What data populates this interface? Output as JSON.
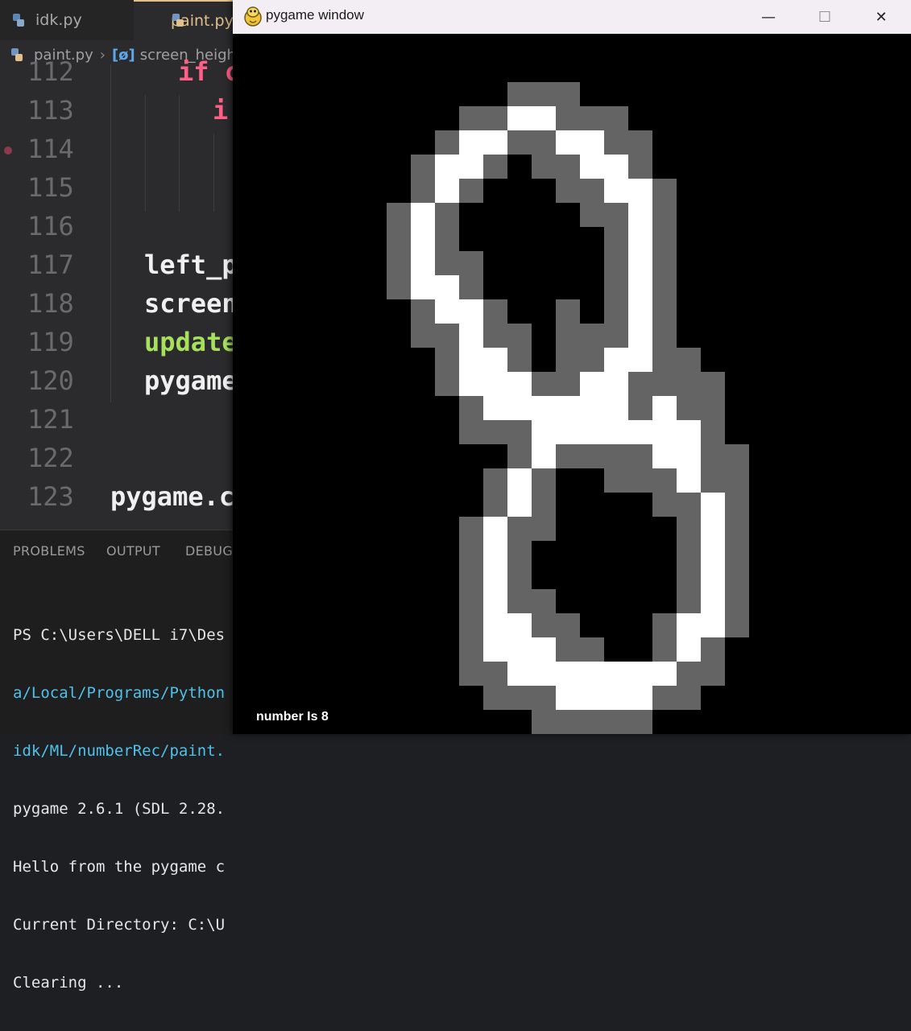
{
  "editor": {
    "tabs": [
      {
        "label": "idk.py"
      },
      {
        "label": "paint.py"
      }
    ],
    "breadcrumb": {
      "file": "paint.py",
      "symbol": "screen_height"
    },
    "code_lines": [
      {
        "num": "112",
        "text": "if c"
      },
      {
        "num": "113",
        "text": "i"
      },
      {
        "num": "114",
        "text": ""
      },
      {
        "num": "115",
        "text": ""
      },
      {
        "num": "116",
        "text": ""
      },
      {
        "num": "117",
        "text": "left_p"
      },
      {
        "num": "118",
        "text": "screen"
      },
      {
        "num": "119",
        "text": "update"
      },
      {
        "num": "120",
        "text": "pygame"
      },
      {
        "num": "121",
        "text": ""
      },
      {
        "num": "122",
        "text": ""
      },
      {
        "num": "123",
        "text": "pygame.c"
      }
    ]
  },
  "panel": {
    "tabs": [
      {
        "label": "PROBLEMS"
      },
      {
        "label": "OUTPUT"
      },
      {
        "label": "DEBUG C"
      }
    ],
    "terminal": [
      {
        "text": "PS C:\\Users\\DELL i7\\Des",
        "kind": "normal"
      },
      {
        "text": "a/Local/Programs/Python",
        "kind": "path"
      },
      {
        "text": "idk/ML/numberRec/paint.",
        "kind": "path"
      },
      {
        "text": "pygame 2.6.1 (SDL 2.28.",
        "kind": "normal"
      },
      {
        "text": "Hello from the pygame c",
        "kind": "normal"
      },
      {
        "text": "Current Directory: C:\\U",
        "kind": "normal"
      },
      {
        "text": "Clearing ...",
        "kind": "normal"
      }
    ]
  },
  "pygame_window": {
    "title": "pygame window",
    "buttons": {
      "minimize": "—",
      "maximize": "☐",
      "close": "✕"
    },
    "result_text": "number Is 8",
    "pixel_grid": {
      "colors": {
        "0": "#000000",
        "1": "#646464",
        "2": "#ffffff"
      },
      "rows": [
        "00000000000000000000000000",
        "00000000000000000000000000",
        "00000000000111000000000000",
        "00000000011221110000000000",
        "00000000122112211000000000",
        "00000001221011221000000000",
        "00000001210001122100000000",
        "00000012100000112100000000",
        "00000012100000012100000000",
        "00000012110000012100000000",
        "00000012210000012100000000",
        "00000001221001012100000000",
        "00000001121101112100000000",
        "00000000122101122110000000",
        "00000000122211221111000000",
        "00000000012222221211000000",
        "00000000011122222221000000",
        "00000000000121111221100000",
        "00000000001210011121100000",
        "00000000001210000112100000",
        "00000000012110000012100000",
        "00000000012100000012100000",
        "00000000012100000012100000",
        "00000000012110000012100000",
        "00000000012211000122100000",
        "00000000012221100121000000",
        "00000000011222222211000000",
        "00000000001112222110000000",
        "00000000000011111000000000",
        "00000000000000000000000000"
      ]
    }
  }
}
